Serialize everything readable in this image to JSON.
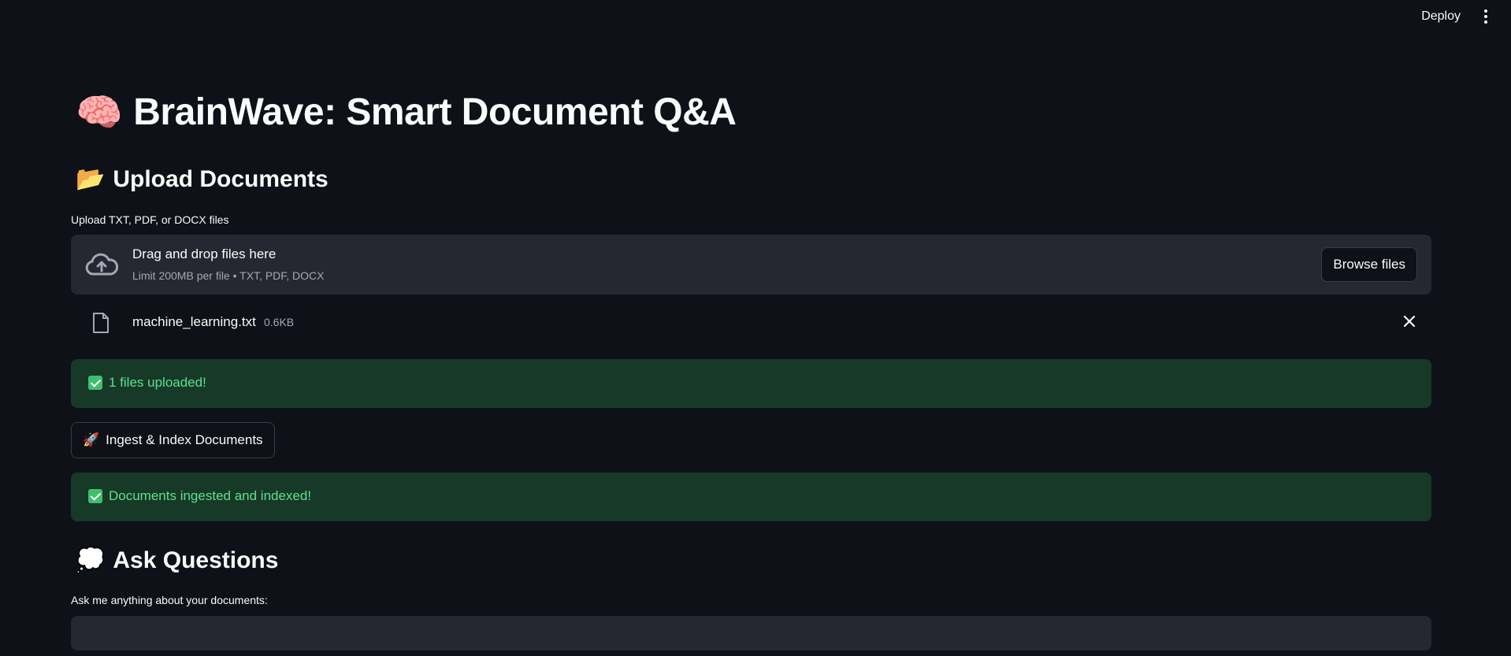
{
  "header": {
    "deploy_label": "Deploy"
  },
  "title": {
    "emoji": "🧠",
    "text": "BrainWave: Smart Document Q&A"
  },
  "upload": {
    "heading_emoji": "📂",
    "heading": "Upload Documents",
    "label": "Upload TXT, PDF, or DOCX files",
    "dropzone_title": "Drag and drop files here",
    "dropzone_sub": "Limit 200MB per file • TXT, PDF, DOCX",
    "browse_label": "Browse files",
    "files": [
      {
        "name": "machine_learning.txt",
        "size": "0.6KB"
      }
    ],
    "success": "1 files uploaded!"
  },
  "ingest": {
    "emoji": "🚀",
    "button_label": "Ingest & Index Documents",
    "success": "Documents ingested and indexed!"
  },
  "ask": {
    "heading_emoji": "💭",
    "heading": "Ask Questions",
    "label": "Ask me anything about your documents:",
    "value": ""
  },
  "colors": {
    "background": "#0e1117",
    "panel": "#262730",
    "success_bg": "#173928",
    "success_text": "#5ee08f"
  }
}
